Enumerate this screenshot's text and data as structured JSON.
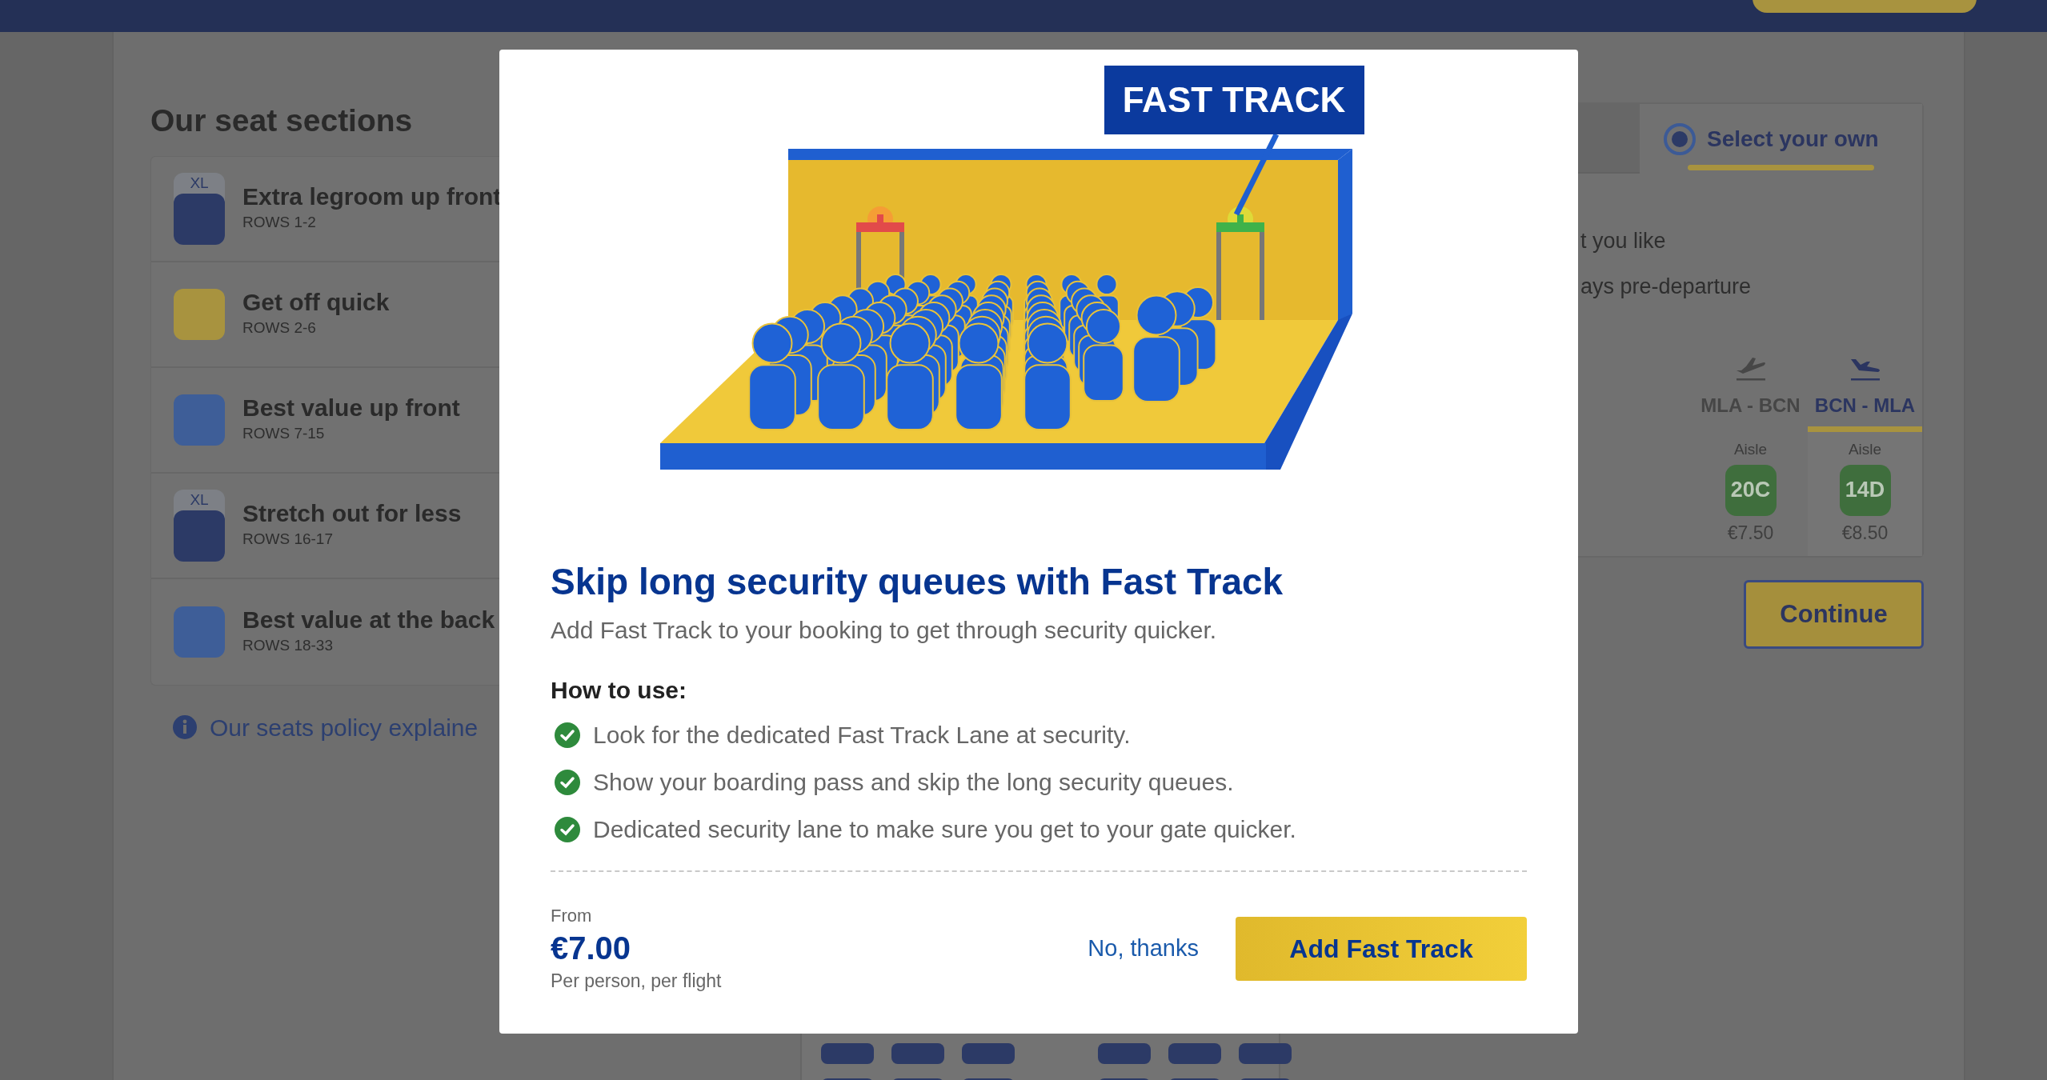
{
  "seat_sections": {
    "title": "Our seat sections",
    "items": [
      {
        "name": "Extra legroom up front",
        "rows": "ROWS 1-2",
        "color": "#2c3a66",
        "badge": "XL"
      },
      {
        "name": "Get off quick",
        "rows": "ROWS 2-6",
        "color": "#a8933f"
      },
      {
        "name": "Best value up front",
        "rows": "ROWS 7-15",
        "color": "#3e5e98"
      },
      {
        "name": "Stretch out for less",
        "rows": "ROWS 16-17",
        "color": "#2c3a66",
        "badge": "XL"
      },
      {
        "name": "Best value at the back",
        "rows": "ROWS 18-33",
        "color": "#3e5e98"
      }
    ],
    "policy_link": "Our seats policy explaine"
  },
  "seat_selection": {
    "tabs": [
      {
        "selected": false
      },
      {
        "label": "Select your own",
        "selected": true
      }
    ],
    "lines": [
      "t you like",
      "ays pre-departure"
    ],
    "flights": [
      {
        "route": "MLA - BCN",
        "selected": false,
        "seat": {
          "position": "Aisle",
          "number": "20C",
          "price": "€7.50"
        }
      },
      {
        "route": "BCN - MLA",
        "selected": true,
        "seat": {
          "position": "Aisle",
          "number": "14D",
          "price": "€8.50"
        }
      }
    ],
    "continue": "Continue"
  },
  "modal": {
    "sign": "FAST TRACK",
    "title": "Skip long security queues with Fast Track",
    "subtitle": "Add Fast Track to your booking to get through security quicker.",
    "how_to": "How to use:",
    "steps": [
      "Look for the dedicated Fast Track Lane at security.",
      "Show your boarding pass and skip the long security queues.",
      "Dedicated security lane to make sure you get to your gate quicker."
    ],
    "price_prefix": "From",
    "price": "€7.00",
    "price_note": "Per person, per flight",
    "decline": "No, thanks",
    "accept": "Add Fast Track"
  }
}
